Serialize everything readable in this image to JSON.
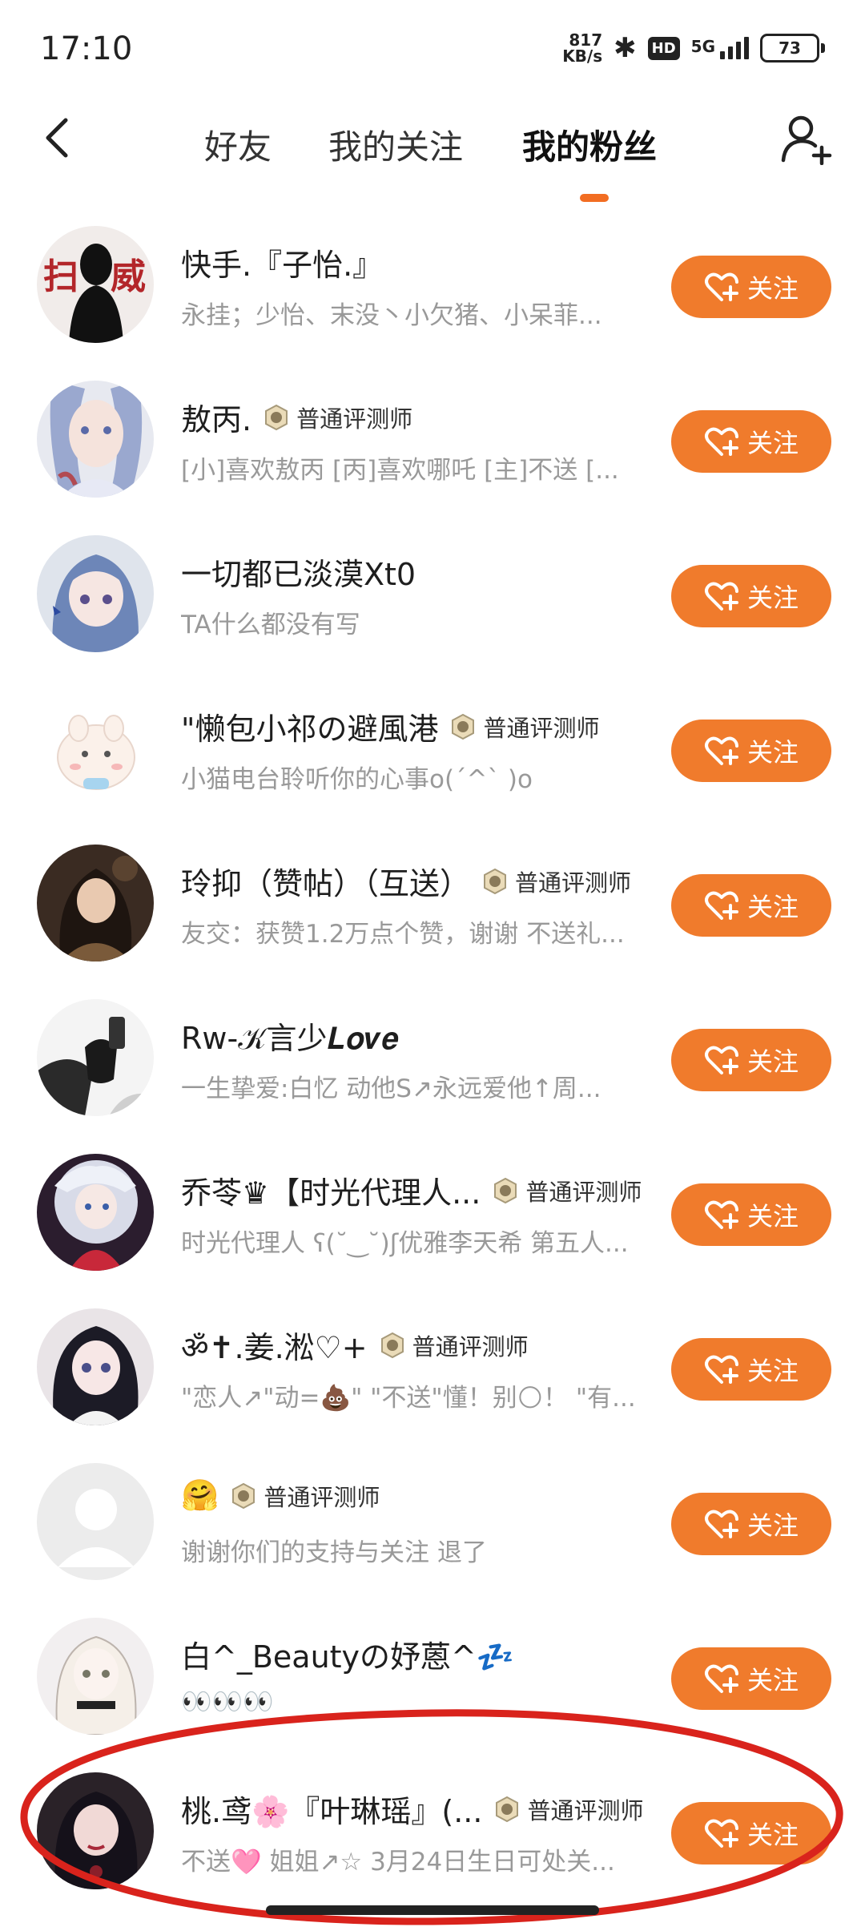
{
  "status_bar": {
    "time": "17:10",
    "net_speed_value": "817",
    "net_speed_unit": "KB/s",
    "hd": "HD",
    "network": "5G",
    "battery": "73"
  },
  "header": {
    "tabs": [
      {
        "label": "好友"
      },
      {
        "label": "我的关注"
      },
      {
        "label": "我的粉丝",
        "active": true
      }
    ],
    "accent_color": "#f26d22"
  },
  "fans": [
    {
      "name": "快手.『子怡.』",
      "badge": "",
      "desc": "永挂；少怡、末没丶小欠猪、小呆菲...",
      "follow_label": "关注"
    },
    {
      "name": "敖丙.",
      "badge": "普通评测师",
      "desc": "[小]喜欢敖丙 [丙]喜欢哪吒 [主]不送 [...",
      "follow_label": "关注"
    },
    {
      "name": "一切都已淡漠Xt0",
      "badge": "",
      "desc": "TA什么都没有写",
      "follow_label": "关注"
    },
    {
      "name": "\"懒包小祁の避風港",
      "badge": "普通评测师",
      "desc": "小猫电台聆听你的心事o(ˊ^ˋ )o",
      "follow_label": "关注"
    },
    {
      "name": "玲抑（赞帖）（互送）",
      "badge": "普通评测师",
      "desc": "友交：获赞1.2万点个赞，谢谢 不送礼...",
      "follow_label": "关注"
    },
    {
      "name": "Rw-𝒦言少𝑳𝒐𝒗𝒆",
      "badge": "",
      "desc": "一生挚爱:白忆 动他S↗永远爱他↑周...",
      "follow_label": "关注"
    },
    {
      "name": "乔苓♛【时光代理人...",
      "badge": "普通评测师",
      "desc": "时光代理人 ʕ(˘‿˘)ʃ优雅李天希 第五人...",
      "follow_label": "关注"
    },
    {
      "name": "ॐ✝.姜.淞♡+",
      "badge": "普通评测师",
      "desc": "\"恋人↗\"动=💩\" \"不送\"懂！别🌕！ \"有...",
      "follow_label": "关注"
    },
    {
      "name": "🤗",
      "badge": "普通评测师",
      "desc": "谢谢你们的支持与关注 退了",
      "follow_label": "关注"
    },
    {
      "name": "白^_Beautyの妤蒽^💤",
      "badge": "",
      "desc": "👀👀👀",
      "follow_label": "关注"
    },
    {
      "name": "桃.鸢🌸『叶琳瑶』(...",
      "badge": "普通评测师",
      "desc": "不送🩷 姐姐↗☆ 3月24日生日可处关...",
      "follow_label": "关注"
    }
  ],
  "colors": {
    "follow_button": "#f07b2c",
    "annotation_circle": "#d9231c"
  }
}
